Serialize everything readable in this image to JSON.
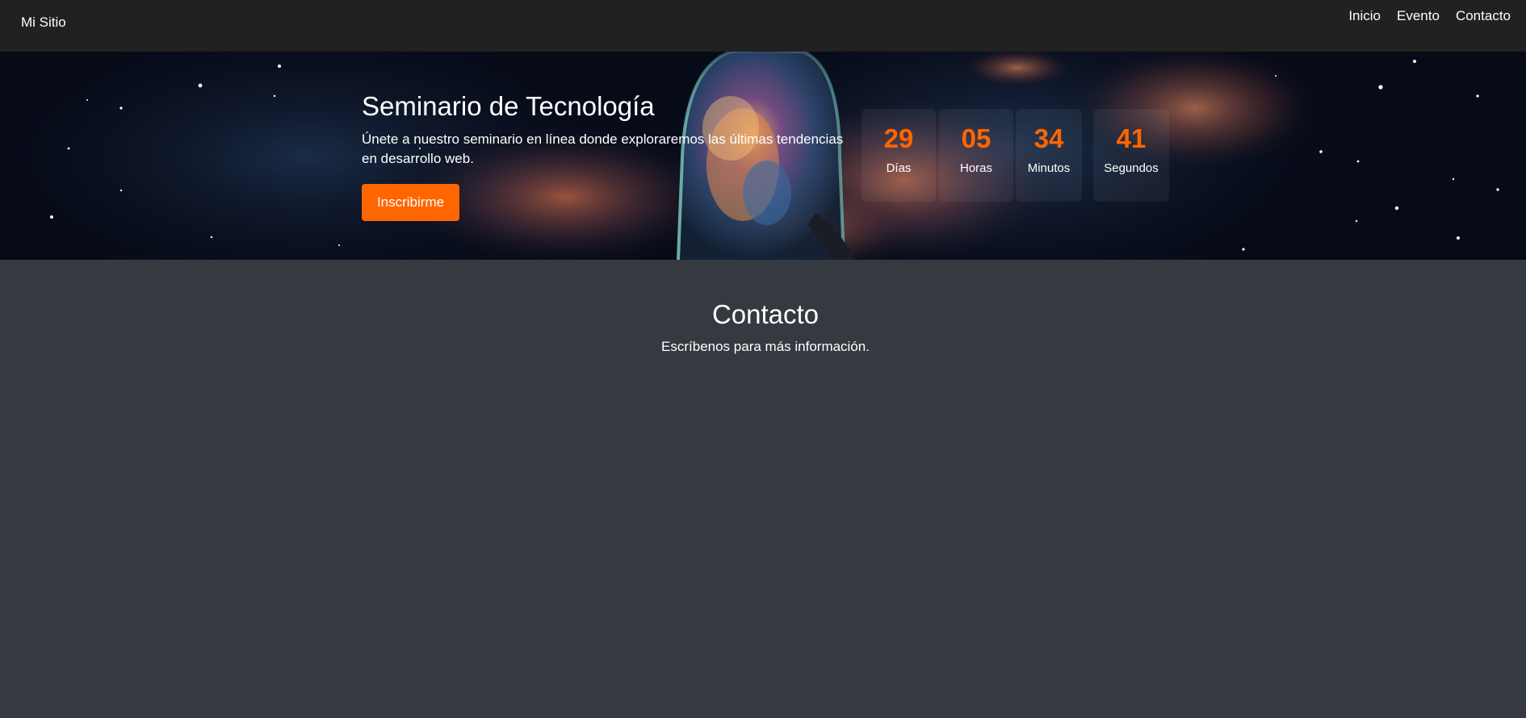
{
  "navbar": {
    "brand": "Mi Sitio",
    "links": [
      "Inicio",
      "Evento",
      "Contacto"
    ]
  },
  "hero": {
    "title": "Seminario de Tecnología",
    "description": "Únete a nuestro seminario en línea donde exploraremos las últimas tendencias en desarrollo web.",
    "cta_label": "Inscribirme",
    "countdown": [
      {
        "value": "29",
        "label": "Días"
      },
      {
        "value": "05",
        "label": "Horas"
      },
      {
        "value": "34",
        "label": "Minutos"
      },
      {
        "value": "41",
        "label": "Segundos"
      }
    ]
  },
  "contact": {
    "title": "Contacto",
    "subtitle": "Escríbenos para más información."
  },
  "colors": {
    "navbar_bg": "#212121",
    "page_bg": "#343a40",
    "accent": "#ff6600",
    "text": "#ffffff"
  },
  "icons": [
    "astronaut-nebula-hero-image"
  ]
}
